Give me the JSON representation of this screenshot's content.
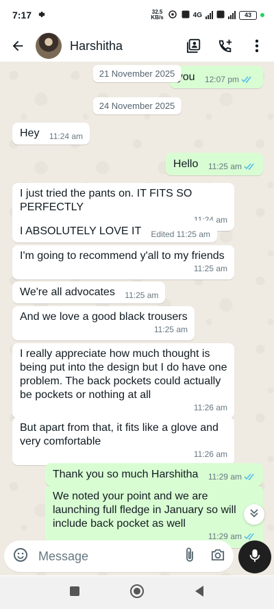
{
  "status_bar": {
    "time": "7:17",
    "speed_value": "32.5",
    "speed_unit": "KB/s",
    "network": "4G",
    "battery": "43",
    "colors": {
      "dot": "#25d366"
    }
  },
  "header": {
    "contact_name": "Harshitha",
    "icons": [
      "back-arrow-icon",
      "contact-card-icon",
      "add-call-icon",
      "more-vert-icon"
    ]
  },
  "chat": {
    "date_chips": [
      "21 November 2025",
      "24 November 2025"
    ],
    "messages": [
      {
        "dir": "out",
        "text": "you",
        "time": "12:07 pm",
        "read": true
      },
      {
        "dir": "in",
        "text": "Hey",
        "time": "11:24 am"
      },
      {
        "dir": "out",
        "text": "Hello",
        "time": "11:25 am",
        "read": true
      },
      {
        "dir": "in",
        "text": "I just tried the pants on. IT FITS SO PERFECTLY",
        "time": "11:24 am"
      },
      {
        "dir": "in",
        "text": "I ABSOLUTELY LOVE IT",
        "time": "Edited 11:25 am"
      },
      {
        "dir": "in",
        "text": "I'm going to recommend y'all to my friends",
        "time": "11:25 am"
      },
      {
        "dir": "in",
        "text": "We're all advocates",
        "time": "11:25 am"
      },
      {
        "dir": "in",
        "text": "And we love a good black trousers",
        "time": "11:25 am"
      },
      {
        "dir": "in",
        "text": "I really appreciate how much thought is being put into the design but I do have one problem. The back pockets could actually be pockets or nothing at all",
        "time": "11:26 am"
      },
      {
        "dir": "in",
        "text": "But apart from that, it fits like a glove and very comfortable",
        "time": "11:26 am"
      },
      {
        "dir": "out",
        "text": "Thank you so much Harshitha",
        "time": "11:29 am",
        "read": true
      },
      {
        "dir": "out",
        "text": "We noted your point and we are launching full fledge in January so will include back pocket as well",
        "time": "11:29 am",
        "read": true
      }
    ],
    "colors": {
      "incoming": "#ffffff",
      "outgoing": "#d9fdd3",
      "tick": "#53bdeb",
      "wallpaper": "#efeae2"
    }
  },
  "composer": {
    "placeholder": "Message",
    "icons": [
      "emoji-icon",
      "attach-icon",
      "camera-icon",
      "mic-icon"
    ]
  },
  "nav": {
    "icons": [
      "recents-square-icon",
      "home-circle-icon",
      "back-triangle-icon"
    ]
  }
}
